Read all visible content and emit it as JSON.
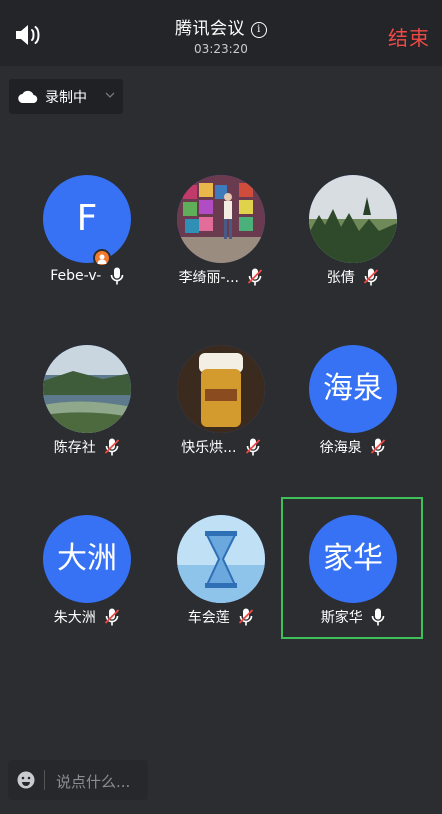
{
  "header": {
    "title": "腾讯会议",
    "info_icon": "i",
    "timer": "03:23:20",
    "end_label": "结束",
    "end_color": "#ef4a45"
  },
  "recording": {
    "label": "录制中"
  },
  "participants": [
    {
      "name": "Febe-v-",
      "avatar_text": "F",
      "mic": "on",
      "host_badge": true
    },
    {
      "name": "李绮丽-...",
      "avatar_text": "",
      "mic": "muted"
    },
    {
      "name": "张倩",
      "avatar_text": "",
      "mic": "muted"
    },
    {
      "name": "陈存社",
      "avatar_text": "",
      "mic": "muted"
    },
    {
      "name": "快乐烘...",
      "avatar_text": "",
      "mic": "muted"
    },
    {
      "name": "徐海泉",
      "avatar_text": "海泉",
      "mic": "muted"
    },
    {
      "name": "朱大洲",
      "avatar_text": "大洲",
      "mic": "muted"
    },
    {
      "name": "车会莲",
      "avatar_text": "",
      "mic": "muted"
    },
    {
      "name": "斯家华",
      "avatar_text": "家华",
      "mic": "on",
      "active_speaker": true
    }
  ],
  "chat": {
    "placeholder": "说点什么..."
  },
  "colors": {
    "accent": "#3772f5",
    "highlight": "#3fbf5a",
    "muted": "#ef4a45"
  }
}
